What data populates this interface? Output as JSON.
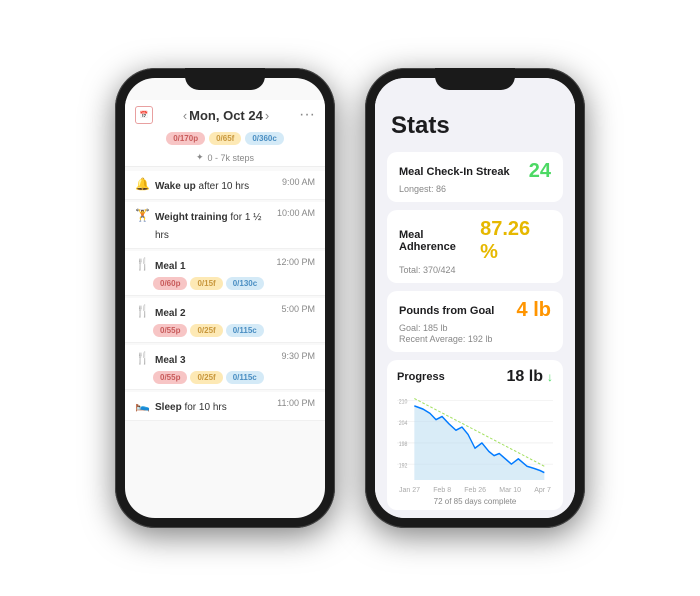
{
  "page": {
    "background": "white"
  },
  "phone1": {
    "header": {
      "title": "Mon, Oct 24",
      "cal_icon": "📅",
      "prev_label": "‹",
      "next_label": "›",
      "more_label": "···"
    },
    "macros": [
      {
        "label": "0/170p",
        "type": "p"
      },
      {
        "label": "0/65f",
        "type": "f"
      },
      {
        "label": "0/360c",
        "type": "c"
      }
    ],
    "steps": "✦  0 - 7k steps",
    "schedule": [
      {
        "icon": "🔔",
        "title": "Wake up",
        "detail": " after 10 hrs",
        "time": "9:00 AM",
        "macros": []
      },
      {
        "icon": "🏋",
        "title": "Weight training",
        "detail": " for 1 ½ hrs",
        "time": "10:00 AM",
        "macros": []
      },
      {
        "icon": "🍴",
        "title": "Meal 1",
        "detail": "",
        "time": "12:00 PM",
        "macros": [
          {
            "label": "0/60p",
            "type": "p"
          },
          {
            "label": "0/15f",
            "type": "f"
          },
          {
            "label": "0/130c",
            "type": "c"
          }
        ]
      },
      {
        "icon": "🍴",
        "title": "Meal 2",
        "detail": "",
        "time": "5:00 PM",
        "macros": [
          {
            "label": "0/55p",
            "type": "p"
          },
          {
            "label": "0/25f",
            "type": "f"
          },
          {
            "label": "0/115c",
            "type": "c"
          }
        ]
      },
      {
        "icon": "🍴",
        "title": "Meal 3",
        "detail": "",
        "time": "9:30 PM",
        "macros": [
          {
            "label": "0/55p",
            "type": "p"
          },
          {
            "label": "0/25f",
            "type": "f"
          },
          {
            "label": "0/115c",
            "type": "c"
          }
        ]
      },
      {
        "icon": "🛌",
        "title": "Sleep",
        "detail": " for 10 hrs",
        "time": "11:00 PM",
        "macros": []
      }
    ]
  },
  "phone2": {
    "title": "Stats",
    "cards": [
      {
        "label": "Meal Check-In Streak",
        "sub": "Longest: 86",
        "value": "24",
        "value_color": "val-green"
      },
      {
        "label": "Meal Adherence",
        "sub": "Total: 370/424",
        "value": "87.26 %",
        "value_color": "val-yellow"
      },
      {
        "label": "Pounds from Goal",
        "sub": "Goal: 185 lb\nRecent Average: 192 lb",
        "value": "4 lb",
        "value_color": "val-orange"
      }
    ],
    "progress": {
      "label": "Progress",
      "value": "18 lb",
      "arrow": "↓",
      "x_labels": [
        "Jan 27",
        "Feb 8",
        "Feb 26",
        "Mar 10",
        "Apr 7"
      ],
      "y_labels": [
        "210",
        "204",
        "198",
        "192"
      ],
      "footer": "72 of 85 days complete"
    }
  }
}
